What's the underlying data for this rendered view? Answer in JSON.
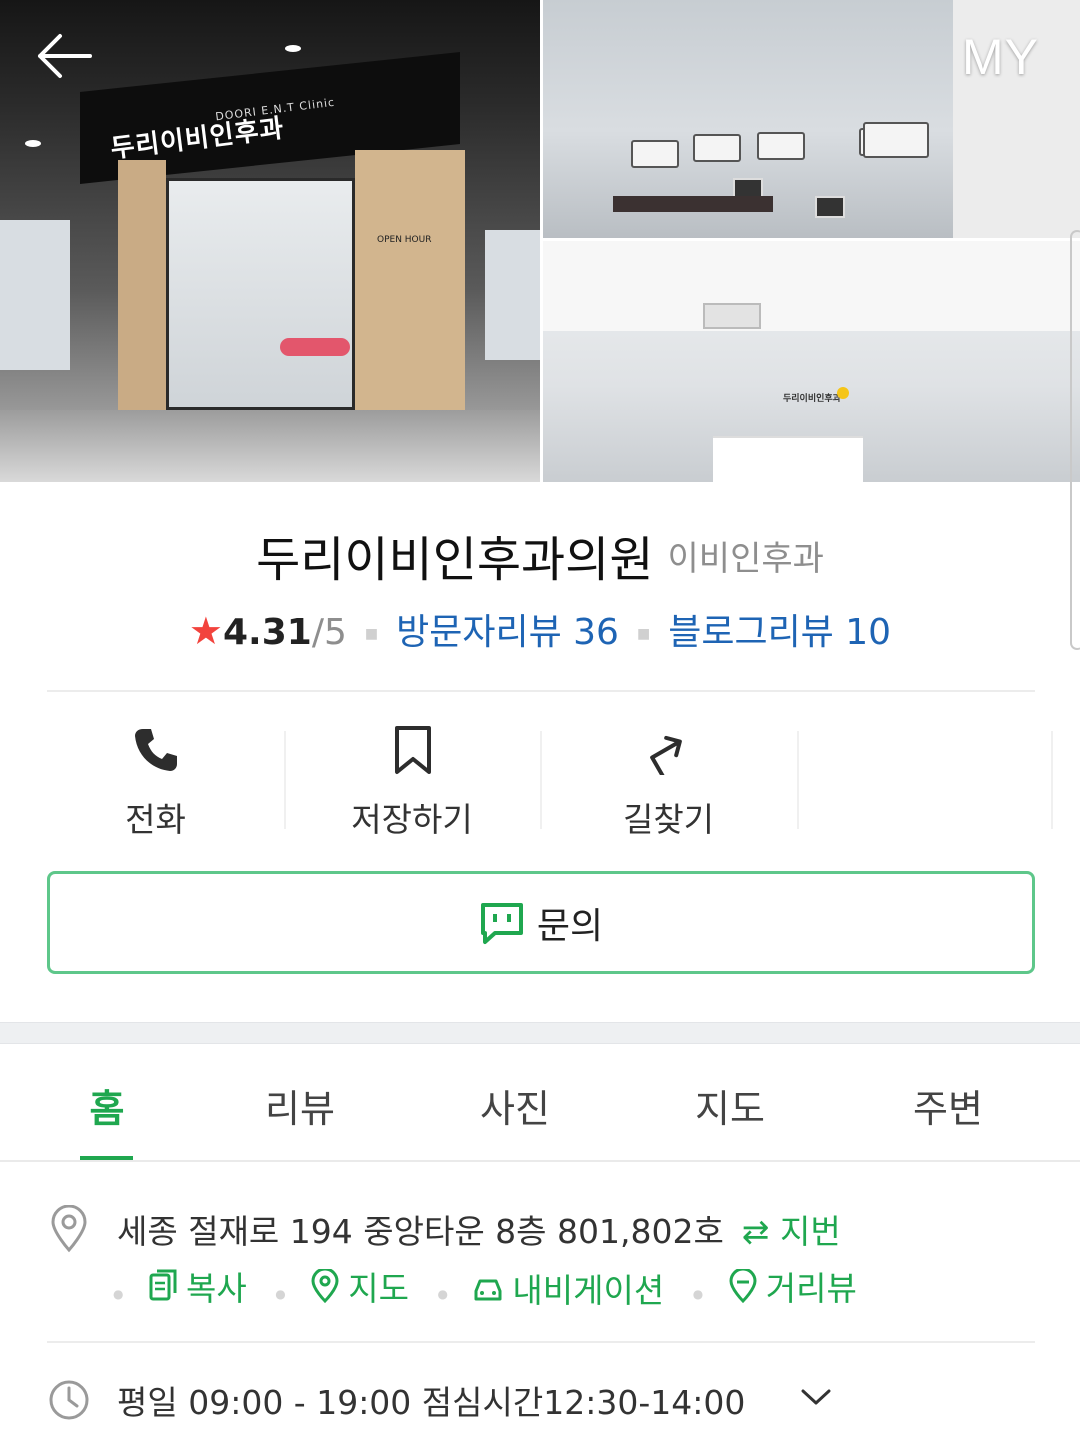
{
  "header": {
    "back_label": "←",
    "my_label": "MY"
  },
  "photos": {
    "main_sign_korean": "두리이비인후과",
    "main_sign_english": "DOORI E.N.T Clinic",
    "open_hour_text": "OPEN HOUR",
    "reception_sign": "두리이비인후과"
  },
  "place": {
    "name": "두리이비인후과의원",
    "category": "이비인후과",
    "rating_score": "4.31",
    "rating_max": "/5",
    "visitor_reviews": "방문자리뷰 36",
    "blog_reviews": "블로그리뷰 10"
  },
  "actions": [
    {
      "label": "전화",
      "icon": "phone-icon"
    },
    {
      "label": "저장하기",
      "icon": "bookmark-icon"
    },
    {
      "label": "길찾기",
      "icon": "directions-icon"
    }
  ],
  "inquiry": {
    "label": "문의",
    "icon": "chat-icon"
  },
  "tabs": [
    {
      "label": "홈",
      "active": true
    },
    {
      "label": "리뷰",
      "active": false
    },
    {
      "label": "사진",
      "active": false
    },
    {
      "label": "지도",
      "active": false
    },
    {
      "label": "주변",
      "active": false
    }
  ],
  "address": {
    "text": "세종 절재로 194 중앙타운 8층 801,802호",
    "jibun_label": "⇄ 지번",
    "actions": [
      {
        "label": "복사",
        "icon": "copy-icon"
      },
      {
        "label": "지도",
        "icon": "map-pin-icon"
      },
      {
        "label": "내비게이션",
        "icon": "car-icon"
      },
      {
        "label": "거리뷰",
        "icon": "streetview-icon"
      }
    ]
  },
  "hours": {
    "text": "평일 09:00 - 19:00 점심시간12:30-14:00"
  },
  "colors": {
    "accent_green": "#1fa74f",
    "link_blue": "#1e64b4",
    "star_red": "#f2433d",
    "inquiry_border": "#5ec78a"
  }
}
